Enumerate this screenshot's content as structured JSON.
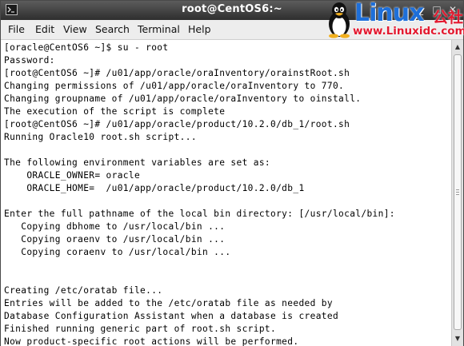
{
  "window": {
    "title": "root@CentOS6:~",
    "minimize_glyph": "_",
    "maximize_glyph": "□",
    "close_glyph": "✕"
  },
  "menu": [
    "File",
    "Edit",
    "View",
    "Search",
    "Terminal",
    "Help"
  ],
  "terminal_lines": [
    "[oracle@CentOS6 ~]$ su - root",
    "Password:",
    "[root@CentOS6 ~]# /u01/app/oracle/oraInventory/orainstRoot.sh",
    "Changing permissions of /u01/app/oracle/oraInventory to 770.",
    "Changing groupname of /u01/app/oracle/oraInventory to oinstall.",
    "The execution of the script is complete",
    "[root@CentOS6 ~]# /u01/app/oracle/product/10.2.0/db_1/root.sh",
    "Running Oracle10 root.sh script...",
    "",
    "The following environment variables are set as:",
    "    ORACLE_OWNER= oracle",
    "    ORACLE_HOME=  /u01/app/oracle/product/10.2.0/db_1",
    "",
    "Enter the full pathname of the local bin directory: [/usr/local/bin]:",
    "   Copying dbhome to /usr/local/bin ...",
    "   Copying oraenv to /usr/local/bin ...",
    "   Copying coraenv to /usr/local/bin ...",
    "",
    "",
    "Creating /etc/oratab file...",
    "Entries will be added to the /etc/oratab file as needed by",
    "Database Configuration Assistant when a database is created",
    "Finished running generic part of root.sh script.",
    "Now product-specific root actions will be performed."
  ],
  "watermark": {
    "brand": "Linux",
    "brand_cn": "公社",
    "url": "www.Linuxidc.com",
    "brand_color": "#1e6fd9",
    "accent_color": "#e3192f"
  },
  "icons": {
    "terminal": "terminal-icon",
    "scroll_up": "scroll-up-arrow-icon",
    "scroll_down": "scroll-down-arrow-icon",
    "mascot": "tux-penguin-icon"
  }
}
